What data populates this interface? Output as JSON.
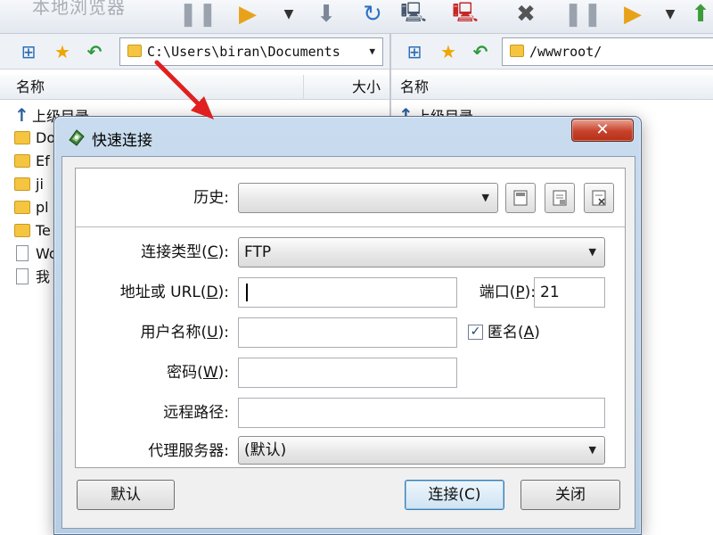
{
  "toolbar": {
    "title_faded": "本地浏览器",
    "icons": [
      "pause-icon",
      "play-icon",
      "download-icon",
      "refresh-icon",
      "computer-icon",
      "disconnect-icon",
      "stop-icon",
      "pause-icon",
      "play-icon"
    ]
  },
  "left_pane": {
    "path": "C:\\Users\\biran\\Documents",
    "columns": {
      "name": "名称",
      "size": "大小"
    },
    "items": [
      {
        "type": "parent",
        "name": "上级目录"
      },
      {
        "type": "folder",
        "name": "Do"
      },
      {
        "type": "folder",
        "name": "Ef"
      },
      {
        "type": "folder",
        "name": "ji"
      },
      {
        "type": "folder",
        "name": "pl"
      },
      {
        "type": "folder",
        "name": "Te"
      },
      {
        "type": "file",
        "name": "Wo"
      },
      {
        "type": "file",
        "name": "我"
      }
    ]
  },
  "right_pane": {
    "path": "/wwwroot/",
    "columns": {
      "name": "名称"
    },
    "items": [
      {
        "type": "parent",
        "name": "上级目录"
      }
    ]
  },
  "dialog": {
    "title": "快速连接",
    "close_label": "✕",
    "history": {
      "label": "历史:",
      "value": ""
    },
    "connection_type": {
      "label": "连接类型(C):",
      "mnemonic": "C",
      "value": "FTP"
    },
    "address": {
      "label_prefix": "地址或 URL(",
      "mnemonic": "D",
      "label_suffix": "):",
      "value": ""
    },
    "port": {
      "label_prefix": "端口(",
      "mnemonic": "P",
      "label_suffix": "):",
      "value": "21"
    },
    "username": {
      "label_prefix": "用户名称(",
      "mnemonic": "U",
      "label_suffix": "):",
      "value": ""
    },
    "anonymous": {
      "label_prefix": "匿名(",
      "mnemonic": "A",
      "label_suffix": ")",
      "checked": true
    },
    "password": {
      "label_prefix": "密码(",
      "mnemonic": "W",
      "label_suffix": "):",
      "value": ""
    },
    "remote_path": {
      "label": "远程路径:",
      "value": ""
    },
    "proxy": {
      "label": "代理服务器:",
      "value": "(默认)"
    },
    "buttons": {
      "default": "默认",
      "connect": "连接(C)",
      "close": "关闭"
    }
  },
  "colors": {
    "accent_blue": "#c9dcef",
    "close_red": "#c7412b",
    "annotation_red": "#e02020"
  }
}
